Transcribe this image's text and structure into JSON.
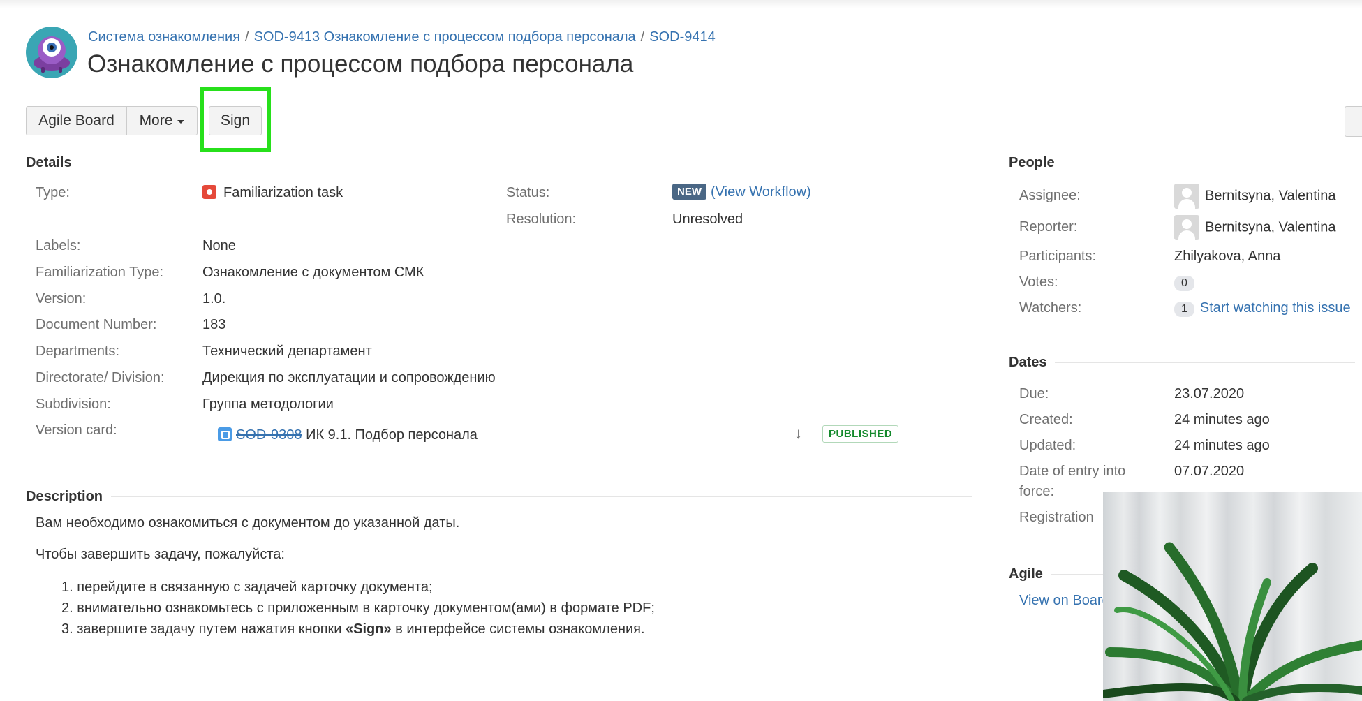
{
  "breadcrumbs": [
    {
      "label": "Система ознакомления"
    },
    {
      "label": "SOD-9413 Ознакомление с процессом подбора персонала"
    },
    {
      "label": "SOD-9414"
    }
  ],
  "breadcrumb_separator": "/",
  "issue_title": "Ознакомление с процессом подбора персонала",
  "toolbar": {
    "agile_board": "Agile Board",
    "more": "More",
    "sign": "Sign"
  },
  "details": {
    "section_title": "Details",
    "type_label": "Type:",
    "type_value": "Familiarization task",
    "status_label": "Status:",
    "status_badge": "NEW",
    "status_link_open": "(",
    "status_link": "View Workflow",
    "status_link_close": ")",
    "resolution_label": "Resolution:",
    "resolution_value": "Unresolved",
    "labels_label": "Labels:",
    "labels_value": "None",
    "fam_type_label": "Familiarization Type:",
    "fam_type_value": "Ознакомление с документом СМК",
    "version_label": "Version:",
    "version_value": "1.0.",
    "docnum_label": "Document Number:",
    "docnum_value": "183",
    "departments_label": "Departments:",
    "departments_value": "Технический департамент",
    "directorate_label": "Directorate/ Division:",
    "directorate_value": "Дирекция по эксплуатации и сопровождению",
    "subdivision_label": "Subdivision:",
    "subdivision_value": "Группа методологии",
    "version_card_label": "Version card:",
    "version_card_key": "SOD-9308",
    "version_card_summary": "ИК 9.1. Подбор персонала",
    "version_card_status": "PUBLISHED"
  },
  "description": {
    "section_title": "Description",
    "line1": "Вам необходимо ознакомиться с документом до указанной даты.",
    "line2": "Чтобы завершить задачу, пожалуйста:",
    "items": [
      {
        "num": "1.",
        "text": "перейдите в связанную с задачей карточку документа;"
      },
      {
        "num": "2.",
        "text": "внимательно ознакомьтесь с приложенным в карточку документом(ами) в формате PDF;"
      }
    ],
    "item3_num": "3.",
    "item3_before": "завершите задачу путем нажатия кнопки ",
    "item3_bold": "«Sign»",
    "item3_after": " в интерфейсе системы ознакомления."
  },
  "people": {
    "section_title": "People",
    "assignee_label": "Assignee:",
    "assignee_value": "Bernitsyna, Valentina",
    "reporter_label": "Reporter:",
    "reporter_value": "Bernitsyna, Valentina",
    "participants_label": "Participants:",
    "participants_value": "Zhilyakova, Anna",
    "votes_label": "Votes:",
    "votes_count": "0",
    "watchers_label": "Watchers:",
    "watchers_count": "1",
    "watch_link": "Start watching this issue"
  },
  "dates": {
    "section_title": "Dates",
    "due_label": "Due:",
    "due_value": "23.07.2020",
    "created_label": "Created:",
    "created_value": "24 minutes ago",
    "updated_label": "Updated:",
    "updated_value": "24 minutes ago",
    "entry_label_1": "Date of entry into",
    "entry_label_2": "force:",
    "entry_value": "07.07.2020",
    "registration_label": "Registration"
  },
  "agile": {
    "section_title": "Agile",
    "view_link": "View on Board"
  },
  "colors": {
    "link": "#3572b0",
    "status_new": "#4a6785",
    "published": "#14892c",
    "highlight": "#27e01b"
  }
}
